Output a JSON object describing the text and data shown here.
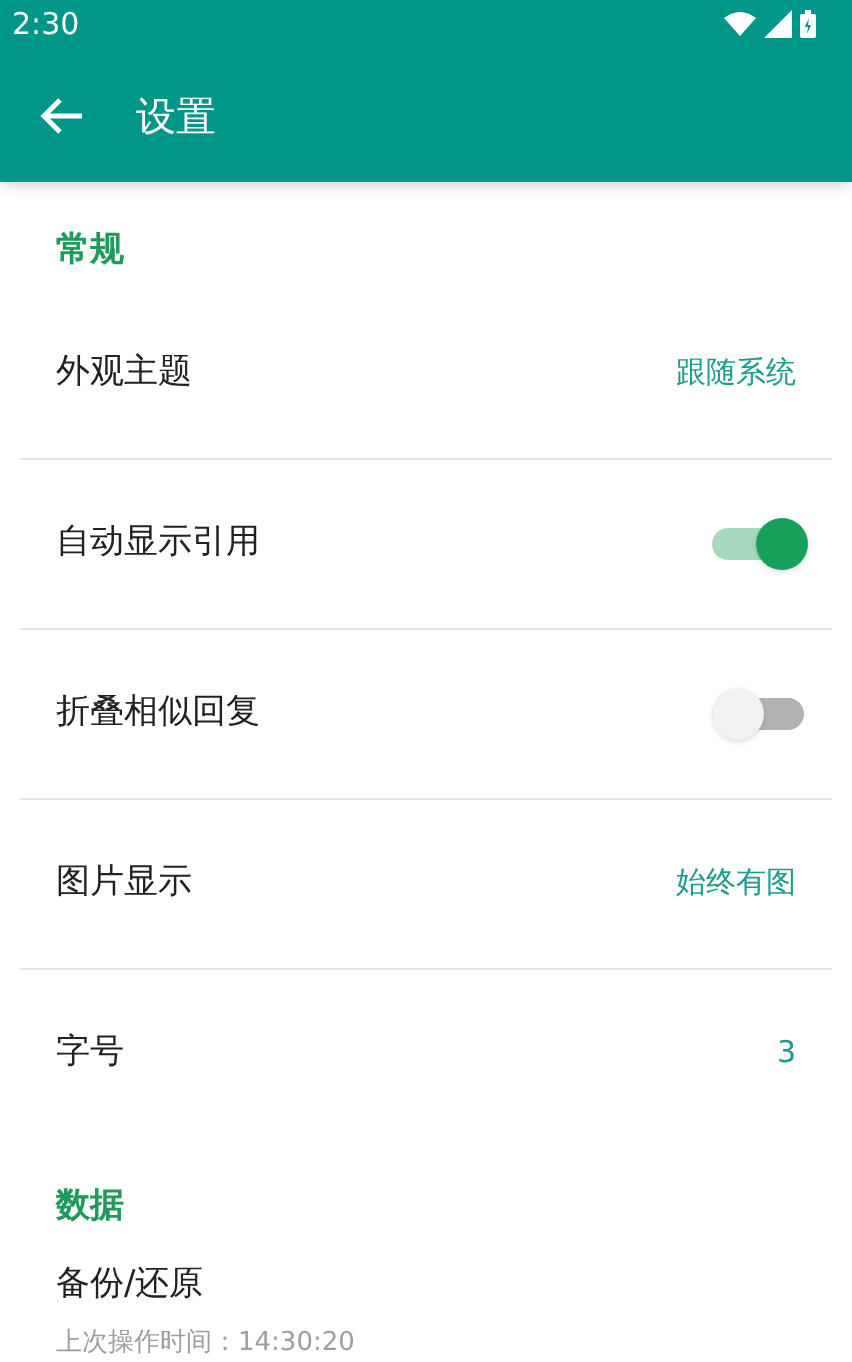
{
  "status_bar": {
    "time": "2:30"
  },
  "toolbar": {
    "title": "设置"
  },
  "sections": [
    {
      "title": "常规",
      "items": [
        {
          "kind": "value",
          "label": "外观主题",
          "value": "跟随系统"
        },
        {
          "kind": "toggle",
          "label": "自动显示引用",
          "on": true
        },
        {
          "kind": "toggle",
          "label": "折叠相似回复",
          "on": false
        },
        {
          "kind": "value",
          "label": "图片显示",
          "value": "始终有图"
        },
        {
          "kind": "value",
          "label": "字号",
          "value": "3"
        }
      ]
    },
    {
      "title": "数据",
      "items": [
        {
          "kind": "subtitle",
          "label": "备份/还原",
          "subtitle": "上次操作时间：14:30:20"
        }
      ]
    }
  ]
}
